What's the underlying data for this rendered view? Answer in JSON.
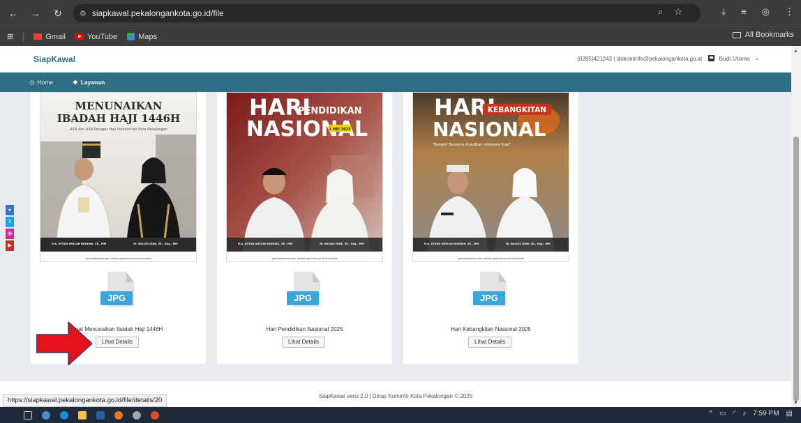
{
  "browser": {
    "url": "siapkawal.pekalongankota.go.id/file",
    "bookmarks": [
      "Gmail",
      "YouTube",
      "Maps"
    ],
    "all_bookmarks": "All Bookmarks",
    "status_url": "https://siapkawal.pekalongankota.go.id/file/details/20"
  },
  "header": {
    "brand": "SiapKawal",
    "contact": "(0285)421243 | diskominfo@pekalongankota.go.id",
    "user": "Budi Utomo"
  },
  "nav": {
    "home": "Home",
    "layanan": "Layanan"
  },
  "posters": [
    {
      "line1": "MENUNAIKAN",
      "line2": "IBADAH HAJI 1446H",
      "sub": "ASN dan ASN Petugas Haji Pemerintah Kota Pekalongan",
      "name_left": "H.A. AFZAN ARSLAN DJUNAID, SE., MM",
      "name_right": "Hj. BALQIS DIAB, SE., SAg., MM",
      "footer": "pemkotpekalongan  pekalongankota.go.id  pemkotpkl"
    },
    {
      "hari": "HARI",
      "sub": "PENDIDIKAN",
      "nasional": "NASIONAL",
      "date": "2 MEI 2025",
      "name_left": "H.A. AFZAN ARSLAN DJUNAID, SE., MM",
      "name_right": "Hj. BALQIS DIAB, SE., SAg., MM",
      "footer": "pemkotpekalongan  pekalongankota.go.id  pemkotpkl"
    },
    {
      "hari": "HARI",
      "sub": "KEBANGKITAN",
      "nasional": "NASIONAL",
      "tagline": "\"Bangkit Bersama Wujudkan Indonesia Kuat\"",
      "name_left": "H.A. AFZAN ARSLAN DJUNAID, SE., MM",
      "name_right": "Hj. BALQIS DIAB, SE., SAg., MM",
      "footer": "pemkotpekalongan  pekalongankota.go.id  pemkotpkl"
    }
  ],
  "files": [
    {
      "type": "JPG",
      "title": "mat Menunaikan Ibadah Haji 1446H",
      "button": "Lihat Details"
    },
    {
      "type": "JPG",
      "title": "Hari Pendidikan Nasional 2025",
      "button": "Lihat Details"
    },
    {
      "type": "JPG",
      "title": "Hari Kebangkitan Nasional 2025",
      "button": "Lihat Details"
    }
  ],
  "footer": "SiapKawal versi 2.0 | Dinas Kominfo Kota Pekalongan © 2025",
  "taskbar": {
    "time": "7:59 PM"
  },
  "colors": {
    "navbar": "#2f6f86",
    "brand": "#2d6f8c",
    "file_tag": "#3ba6d9",
    "arrow": "#e4131b"
  }
}
